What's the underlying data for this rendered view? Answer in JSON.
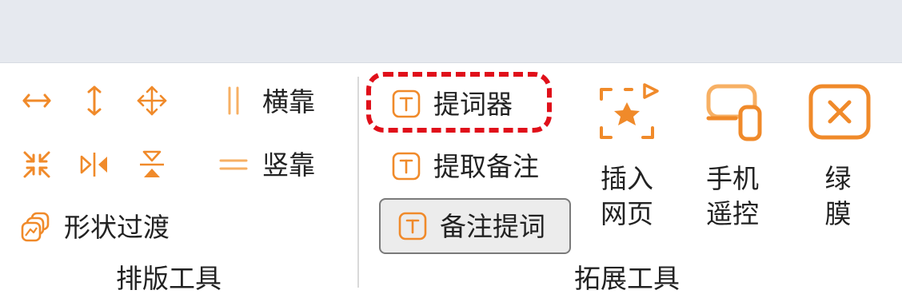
{
  "colors": {
    "accent": "#f08a2a",
    "accent_light": "#f7b064",
    "highlight": "#e0101a"
  },
  "layout_tools": {
    "title": "排版工具",
    "horizontal_dock": "横靠",
    "vertical_dock": "竖靠",
    "shape_transition": "形状过渡",
    "icons": [
      "horizontal-spread-icon",
      "vertical-spread-icon",
      "move-all-icon",
      "shrink-icon",
      "mirror-horizontal-icon",
      "mirror-vertical-icon"
    ]
  },
  "extend_tools": {
    "title": "拓展工具",
    "teleprompter": "提词器",
    "extract_notes": "提取备注",
    "notes_prompt": "备注提词",
    "insert_webpage_line1": "插入",
    "insert_webpage_line2": "网页",
    "phone_remote_line1": "手机",
    "phone_remote_line2": "遥控",
    "green_screen_line1": "绿",
    "green_screen_line2": "膜"
  }
}
